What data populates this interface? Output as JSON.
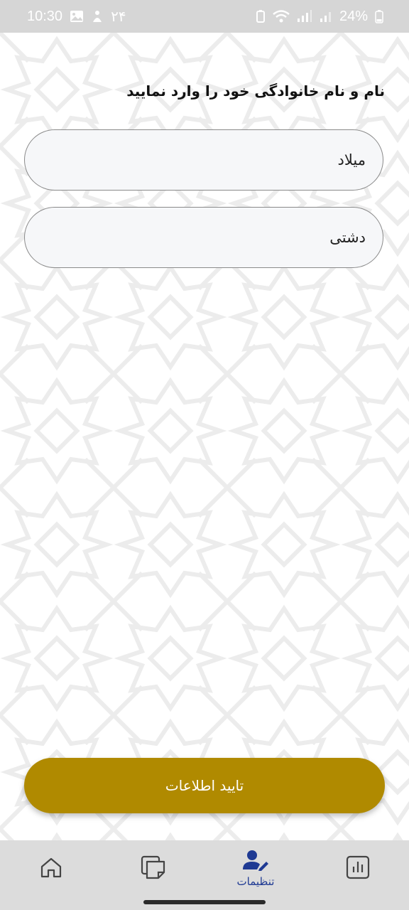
{
  "status_bar": {
    "time": "10:30",
    "extra": "۲۴",
    "battery": "24%"
  },
  "form": {
    "heading": "نام و نام خانوادگی خود را وارد نمایید",
    "first_name_value": "میلاد",
    "last_name_value": "دشتی",
    "submit_label": "تایید اطلاعات"
  },
  "bottom_nav": {
    "items": [
      {
        "icon": "home-icon",
        "label": ""
      },
      {
        "icon": "notes-icon",
        "label": ""
      },
      {
        "icon": "user-edit-icon",
        "label": "تنظیمات"
      },
      {
        "icon": "chart-icon",
        "label": ""
      }
    ],
    "active_color": "#1f3a93"
  },
  "colors": {
    "accent": "#b08a00",
    "status_bar": "#d6d6d6",
    "nav_bar": "#dcdcdc"
  }
}
